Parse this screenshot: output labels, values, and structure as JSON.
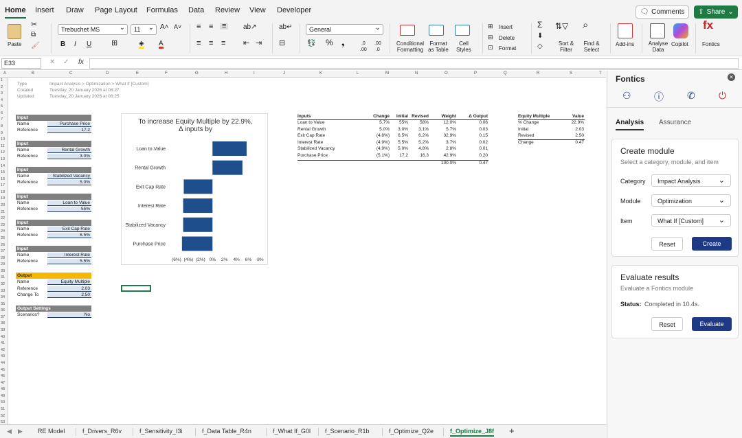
{
  "menu": {
    "tabs": [
      "Home",
      "Insert",
      "Draw",
      "Page Layout",
      "Formulas",
      "Data",
      "Review",
      "View",
      "Developer"
    ],
    "comments": "Comments",
    "share": "Share"
  },
  "ribbon": {
    "paste": "Paste",
    "font": "Trebuchet MS",
    "size": "11",
    "number_format": "General",
    "insert": "Insert",
    "delete": "Delete",
    "format": "Format",
    "cond_format": [
      "Conditional",
      "Formatting"
    ],
    "format_table": [
      "Format",
      "as Table"
    ],
    "cell_styles": [
      "Cell",
      "Styles"
    ],
    "sort_filter": [
      "Sort &",
      "Filter"
    ],
    "find_select": [
      "Find &",
      "Select"
    ],
    "addins": "Add-ins",
    "analyse": [
      "Analyse",
      "Data"
    ],
    "copilot": "Copilot",
    "fontics": "Fontics"
  },
  "formula_bar": {
    "cell_ref": "E33",
    "fx": "fx",
    "value": ""
  },
  "columns": [
    "A",
    "B",
    "C",
    "D",
    "E",
    "F",
    "G",
    "H",
    "I",
    "J",
    "K",
    "L",
    "M",
    "N",
    "O",
    "P",
    "Q",
    "R",
    "S",
    "T"
  ],
  "rows": [
    "1",
    "2",
    "3",
    "4",
    "5",
    "6",
    "7",
    "8",
    "9",
    "10",
    "11",
    "12",
    "13",
    "14",
    "15",
    "16",
    "17",
    "18",
    "19",
    "20",
    "21",
    "22",
    "23",
    "24",
    "25",
    "26",
    "27",
    "28",
    "29",
    "30",
    "31",
    "32",
    "33",
    "34",
    "35",
    "36",
    "37",
    "38",
    "39",
    "40",
    "41",
    "42",
    "43",
    "44",
    "45",
    "46",
    "47",
    "48",
    "49",
    "50",
    "51",
    "52",
    "53"
  ],
  "meta": {
    "type_label": "Type",
    "type_value": "Impact Analysis > Optimization > What If [Custom]",
    "created_label": "Created",
    "created_value": "Tuesday, 20 January 2026 at 08:27",
    "updated_label": "Updated",
    "updated_value": "Tuesday, 20 January 2026 at 08:25"
  },
  "blocks": [
    {
      "header": "Input",
      "name": "Purchase Price",
      "reference": "17.2"
    },
    {
      "header": "Input",
      "name": "Rental Growth",
      "reference": "3.0%"
    },
    {
      "header": "Input",
      "name": "Stabilized Vacancy",
      "reference": "5.0%"
    },
    {
      "header": "Input",
      "name": "Loan to Value",
      "reference": "55%"
    },
    {
      "header": "Input",
      "name": "Exit Cap Rate",
      "reference": "6.5%"
    },
    {
      "header": "Input",
      "name": "Interest Rate",
      "reference": "5.5%"
    }
  ],
  "labels": {
    "name": "Name",
    "reference": "Reference",
    "change_to": "Change To",
    "scenarios": "Scenarios?"
  },
  "output": {
    "header": "Output",
    "name": "Equity Multiple",
    "reference": "2.03",
    "change_to": "2.50"
  },
  "settings": {
    "header": "Output Settings",
    "scenarios": "No"
  },
  "chart_data": {
    "type": "bar",
    "orientation": "horizontal",
    "title": "To increase Equity Multiple by 22.9%, Δ inputs by",
    "categories": [
      "Loan to Value",
      "Rental Growth",
      "Exit Cap Rate",
      "Interest Rate",
      "Stabilized Vacancy",
      "Purchase Price"
    ],
    "values": [
      5.7,
      5.0,
      -4.8,
      -4.9,
      -4.9,
      -5.1
    ],
    "xlim": [
      -6,
      8
    ],
    "ticks": [
      "(6%)",
      "(4%)",
      "(2%)",
      "0%",
      "2%",
      "4%",
      "6%",
      "8%"
    ],
    "color": "#1f4e8c"
  },
  "inputs_table": {
    "headers": [
      "Inputs",
      "Change",
      "Initial",
      "Revised",
      "Weight",
      "Δ Output"
    ],
    "rows": [
      [
        "Loan to Value",
        "5.7%",
        "55%",
        "58%",
        "12.0%",
        "0.06"
      ],
      [
        "Rental Growth",
        "5.0%",
        "3.0%",
        "3.1%",
        "5.7%",
        "0.03"
      ],
      [
        "Exit Cap Rate",
        "(4.8%)",
        "6.5%",
        "6.2%",
        "32.9%",
        "0.15"
      ],
      [
        "Interest Rate",
        "(4.9%)",
        "5.5%",
        "5.2%",
        "3.7%",
        "0.02"
      ],
      [
        "Stabilized Vacancy",
        "(4.9%)",
        "5.0%",
        "4.8%",
        "2.8%",
        "0.01"
      ],
      [
        "Purchase Price",
        "(5.1%)",
        "17.2",
        "16.3",
        "42.9%",
        "0.20"
      ]
    ],
    "totals": [
      "100.0%",
      "0.47"
    ]
  },
  "em_table": {
    "headers": [
      "Equity Multiple",
      "Value"
    ],
    "rows": [
      [
        "% Change",
        "22.9%"
      ],
      [
        "Initial",
        "2.03"
      ],
      [
        "Revised",
        "2.50"
      ],
      [
        "Change",
        "0.47"
      ]
    ]
  },
  "sheet_tabs": [
    "RE Model",
    "f_Drivers_R6v",
    "f_Sensitivity_I3i",
    "f_Data Table_R4n",
    "f_What If_G0l",
    "f_Scenario_R1b",
    "f_Optimize_Q2e",
    "f_Optimize_J8f"
  ],
  "pane": {
    "title": "Fontics",
    "tabs": [
      "Analysis",
      "Assurance"
    ],
    "create": {
      "title": "Create module",
      "subtitle": "Select a category, module, and item",
      "category_label": "Category",
      "category": "Impact Analysis",
      "module_label": "Module",
      "module": "Optimization",
      "item_label": "Item",
      "item": "What If [Custom]",
      "reset": "Reset",
      "create": "Create"
    },
    "evaluate": {
      "title": "Evaluate results",
      "subtitle": "Evaluate a Fontics module",
      "status_label": "Status:",
      "status": "Completed in 10.4s.",
      "reset": "Reset",
      "evaluate": "Evaluate"
    }
  }
}
